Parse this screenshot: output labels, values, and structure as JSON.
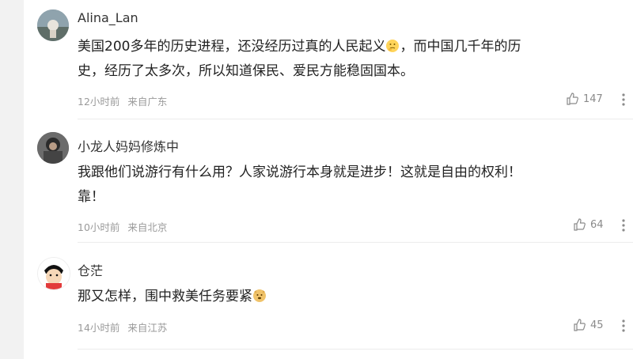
{
  "comments": [
    {
      "username": "Alina_Lan",
      "text_line1": "美国200多年的历史进程，还没经历过真的人民起义",
      "text_line1b": "，而中国几千年的历",
      "text_line2": "史，经历了太多次，所以知道保民、爱民方能稳固国本。",
      "emoji": "thinking-face-emoji",
      "time": "12小时前",
      "location": "来自广东",
      "likes": "147"
    },
    {
      "username": "小龙人妈妈修炼中",
      "text_line1": "我跟他们说游行有什么用？人家说游行本身就是进步！这就是自由的权利！",
      "text_line2": "靠！",
      "time": "10小时前",
      "location": "来自北京",
      "likes": "64"
    },
    {
      "username": "仓茫",
      "text_line1": "那又怎样，围中救美任务要紧",
      "emoji": "doge-emoji",
      "time": "14小时前",
      "location": "来自江苏",
      "likes": "45"
    }
  ],
  "colors": {
    "background": "#f2f2f2",
    "panel": "#ffffff",
    "text": "#222222",
    "meta": "#9a9a9a"
  }
}
